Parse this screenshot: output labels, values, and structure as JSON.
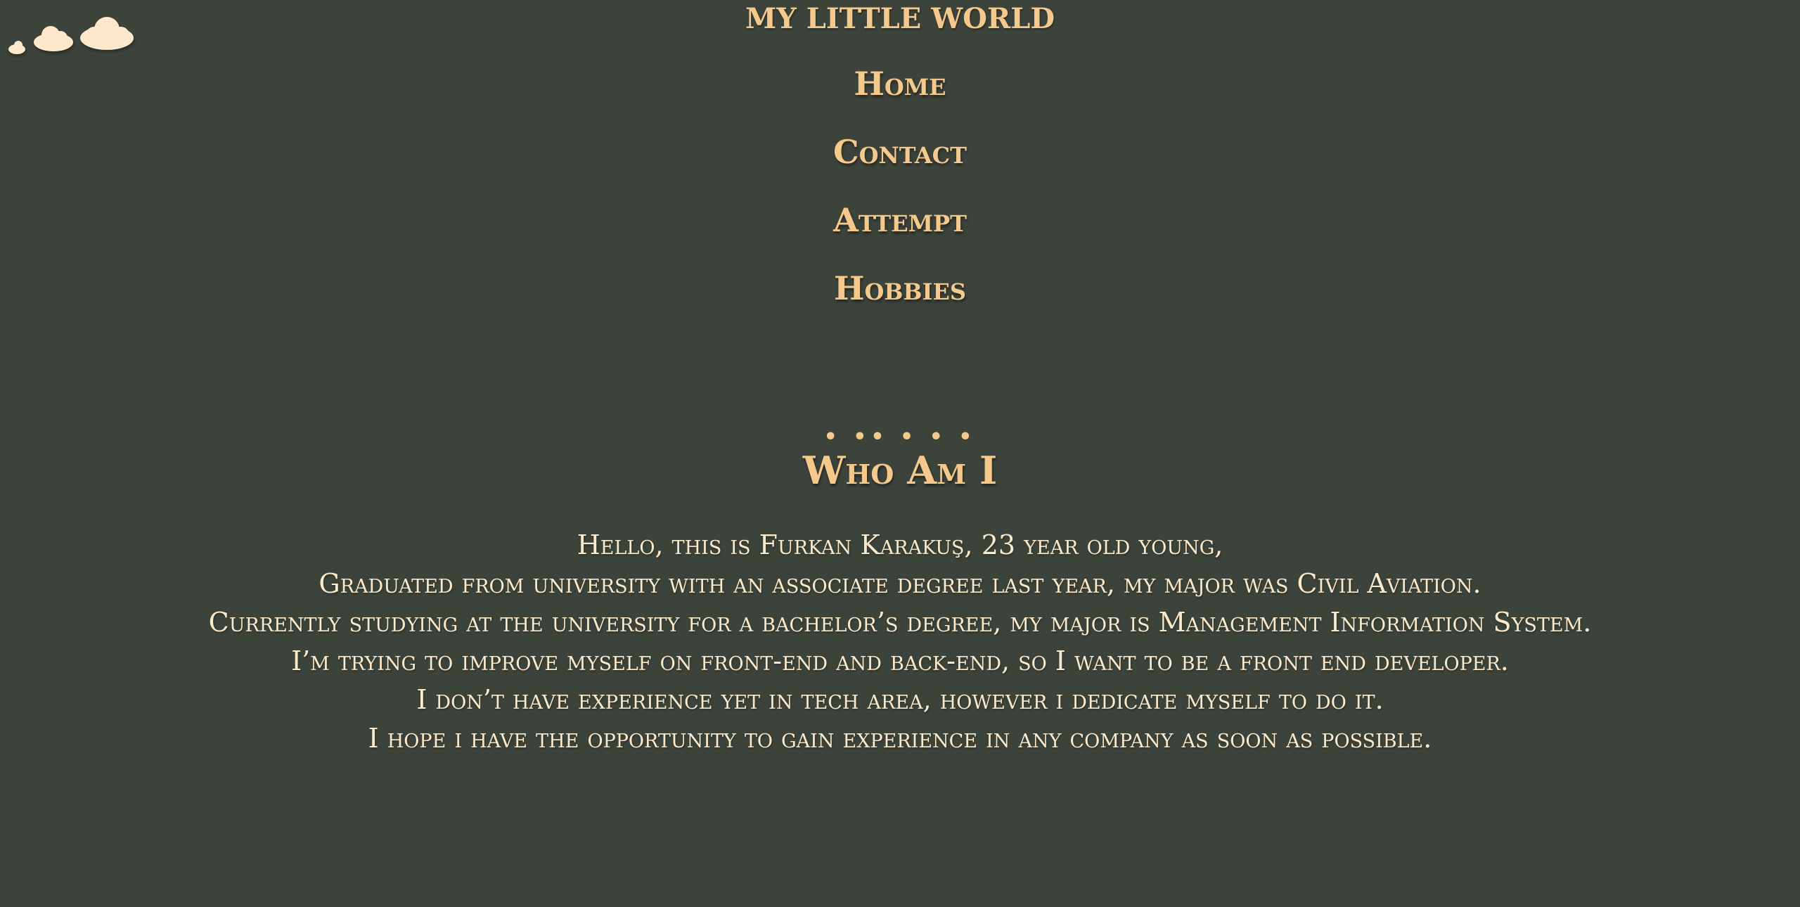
{
  "header": {
    "site_title": "MY LITTLE WORLD"
  },
  "decorations": {
    "clouds_icon": "clouds-icon"
  },
  "nav": {
    "items": [
      {
        "label": "Home"
      },
      {
        "label": "Contact"
      },
      {
        "label": "Attempt"
      },
      {
        "label": "Hobbies"
      }
    ]
  },
  "about": {
    "dots": "• •• • • •",
    "title": "Who Am I",
    "lines": [
      "Hello, this is Furkan Karakuş, 23 year old young,",
      "Graduated from university with an associate degree last year, my major was Civil Aviation.",
      "Currently studying at the university for a bachelor’s degree, my major is Management Information System.",
      "I’m trying to improve myself on front-end and back-end, so I want to be a front end developer.",
      "I don’t have experience yet in tech area, however i dedicate myself to do it.",
      "I hope i have the opportunity to gain experience in any company as soon as possible."
    ]
  },
  "colors": {
    "background": "#3c433b",
    "accent": "#f4c98b",
    "body_text": "#fbe9cc",
    "cloud": "#fde8cc"
  }
}
